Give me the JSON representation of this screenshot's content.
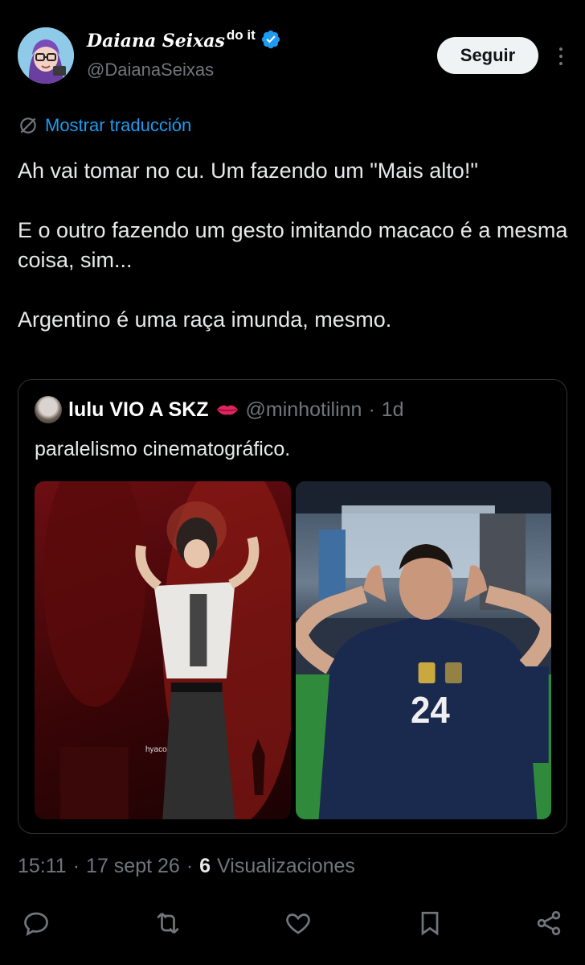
{
  "author": {
    "display_name": "Daiana Seixas",
    "display_name_suffix": "do it",
    "handle": "@DaianaSeixas",
    "verified_color": "#1d9bf0"
  },
  "follow_button": "Seguir",
  "translate_label": "Mostrar traducción",
  "tweet": {
    "lines": [
      "Ah vai tomar no cu. Um fazendo um \"Mais alto!\"",
      "E o outro fazendo um gesto imitando macaco é a mesma coisa, sim...",
      "Argentino é uma raça imunda, mesmo."
    ]
  },
  "quote": {
    "name": "lulu VIO A SKZ",
    "handle": "@minhotilinn",
    "separator": "·",
    "time": "1d",
    "text": "paralelismo cinematográfico.",
    "left_image_watermark": "hyaco",
    "right_image_jersey_number": "24"
  },
  "meta": {
    "time": "15:11",
    "dot1": "·",
    "date": "17 sept 26",
    "dot2": "·",
    "views_count": "6",
    "views_label": "Visualizaciones"
  },
  "icons": {
    "reply": "reply-icon",
    "retweet": "retweet-icon",
    "like": "like-icon",
    "bookmark": "bookmark-icon",
    "share": "share-icon"
  },
  "colors": {
    "background": "#000000",
    "accent": "#1d9bf0",
    "muted": "#71767b",
    "text": "#e7e9ea"
  }
}
